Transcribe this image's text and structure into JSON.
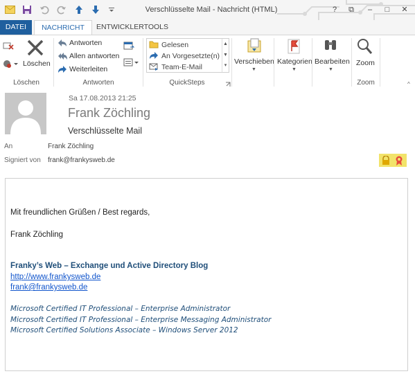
{
  "window": {
    "title": "Verschlüsselte Mail - Nachricht (HTML)",
    "controls": [
      "?",
      "⧉",
      "–",
      "□",
      "✕"
    ]
  },
  "tabs": [
    "DATEI",
    "NACHRICHT",
    "ENTWICKLERTOOLS"
  ],
  "ribbon": {
    "loeschen": {
      "button": "Löschen",
      "group": "Löschen"
    },
    "antworten": {
      "items": [
        "Antworten",
        "Allen antworten",
        "Weiterleiten"
      ],
      "group": "Antworten"
    },
    "quicksteps": {
      "items": [
        "Gelesen",
        "An Vorgesetzte(n)",
        "Team-E-Mail"
      ],
      "group": "QuickSteps"
    },
    "verschieben": {
      "label": "Verschieben"
    },
    "kategorien": {
      "label": "Kategorien"
    },
    "bearbeiten": {
      "label": "Bearbeiten"
    },
    "zoom": {
      "label": "Zoom",
      "group": "Zoom"
    }
  },
  "header": {
    "date": "Sa 17.08.2013 21:25",
    "sender": "Frank Zöchling",
    "subject": "Verschlüsselte Mail",
    "to_label": "An",
    "to_value": "Frank Zöchling",
    "signed_label": "Signiert von",
    "signed_value": "frank@frankysweb.de"
  },
  "body": {
    "greeting": "Mit freundlichen Grüßen / Best regards,",
    "name": "Frank Zöchling",
    "blog": "Franky’s Web – Exchange und Active Directory Blog",
    "url": "http://www.frankysweb.de",
    "email": "frank@frankysweb.de",
    "certs": [
      "Microsoft Certified IT Professional – Enterprise Administrator",
      "Microsoft Certified IT Professional – Enterprise Messaging Administrator",
      "Microsoft Certified Solutions Associate – Windows Server 2012"
    ]
  },
  "colors": {
    "accent": "#1f5f9e",
    "link": "#1155cc",
    "signature": "#1f4e79"
  }
}
